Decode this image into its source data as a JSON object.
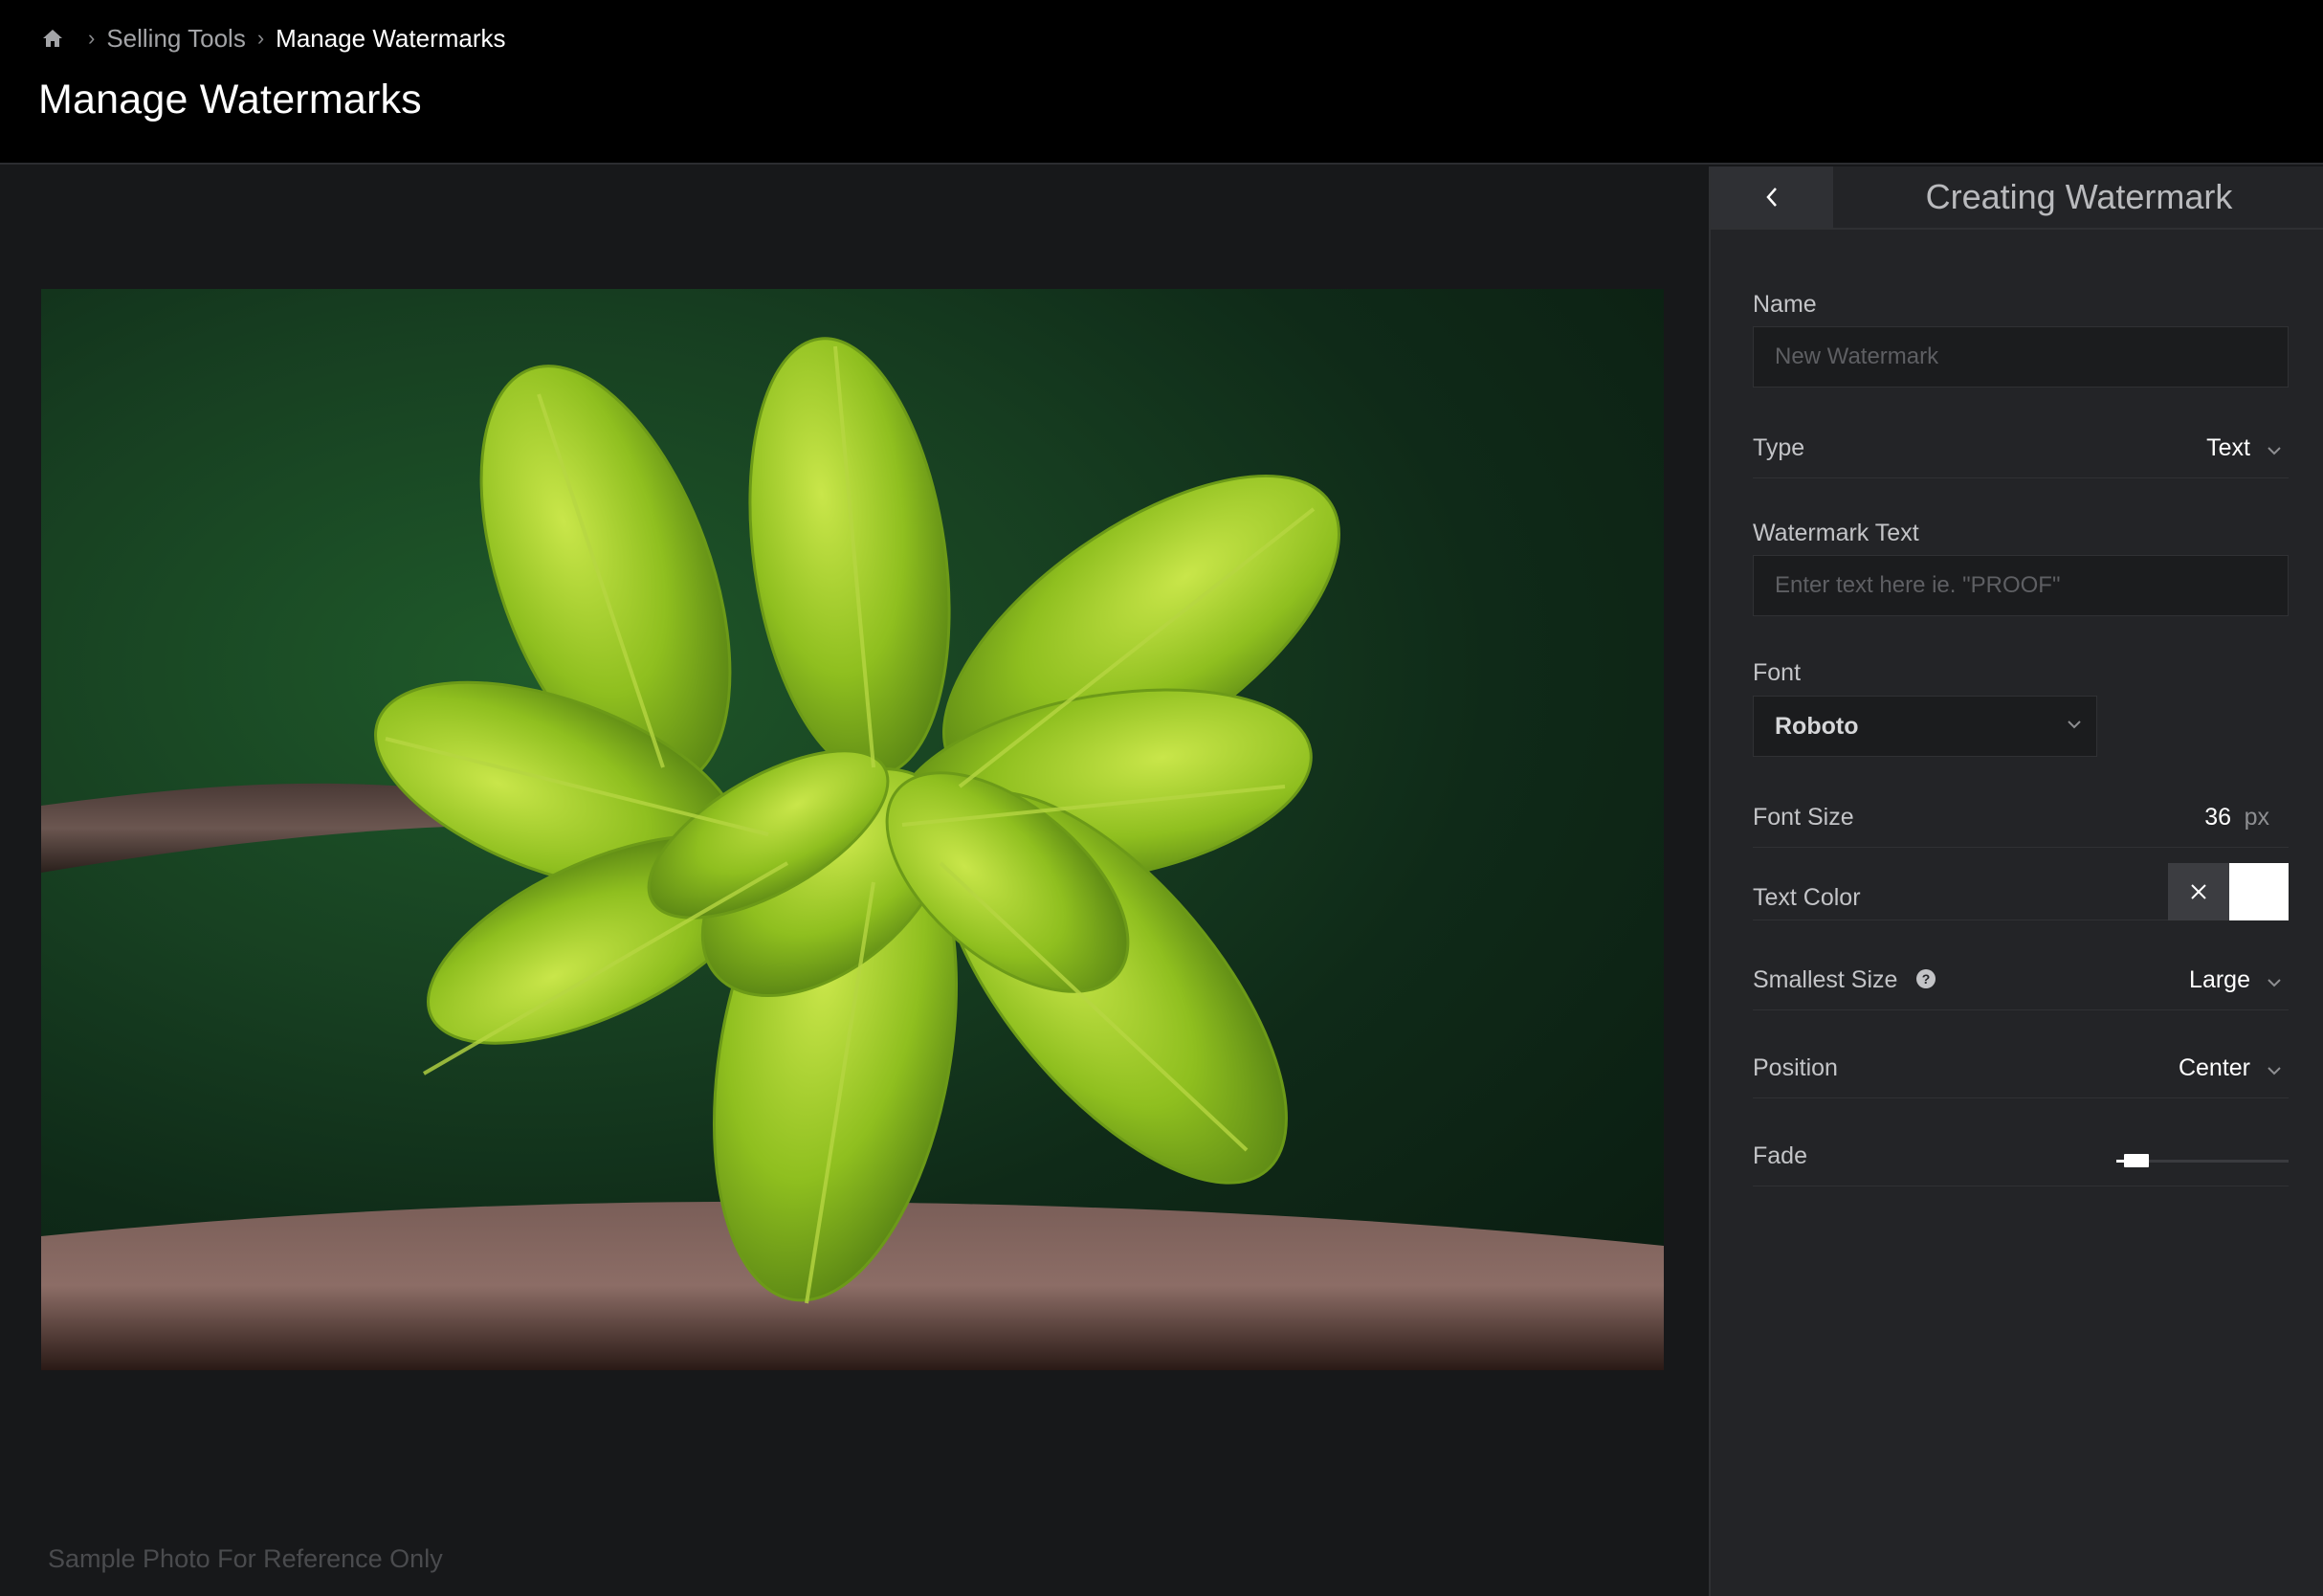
{
  "breadcrumb": {
    "home_icon": "home-icon",
    "items": [
      "Selling Tools",
      "Manage Watermarks"
    ]
  },
  "page": {
    "title": "Manage Watermarks"
  },
  "preview": {
    "caption": "Sample Photo For Reference Only"
  },
  "panel": {
    "title": "Creating Watermark",
    "back_icon": "chevron-left-icon",
    "name": {
      "label": "Name",
      "value": "",
      "placeholder": "New Watermark"
    },
    "type": {
      "label": "Type",
      "value": "Text"
    },
    "watermark_text": {
      "label": "Watermark Text",
      "value": "",
      "placeholder": "Enter text here ie. \"PROOF\""
    },
    "font": {
      "label": "Font",
      "value": "Roboto"
    },
    "font_size": {
      "label": "Font Size",
      "value": "36",
      "unit": "px"
    },
    "text_color": {
      "label": "Text Color",
      "value": "#ffffff"
    },
    "smallest_size": {
      "label": "Smallest Size",
      "value": "Large"
    },
    "position": {
      "label": "Position",
      "value": "Center"
    },
    "fade": {
      "label": "Fade",
      "level": 0.05
    }
  },
  "colors": {
    "header_bg": "#000000",
    "panel_bg": "#232427",
    "page_bg": "#17181a"
  }
}
